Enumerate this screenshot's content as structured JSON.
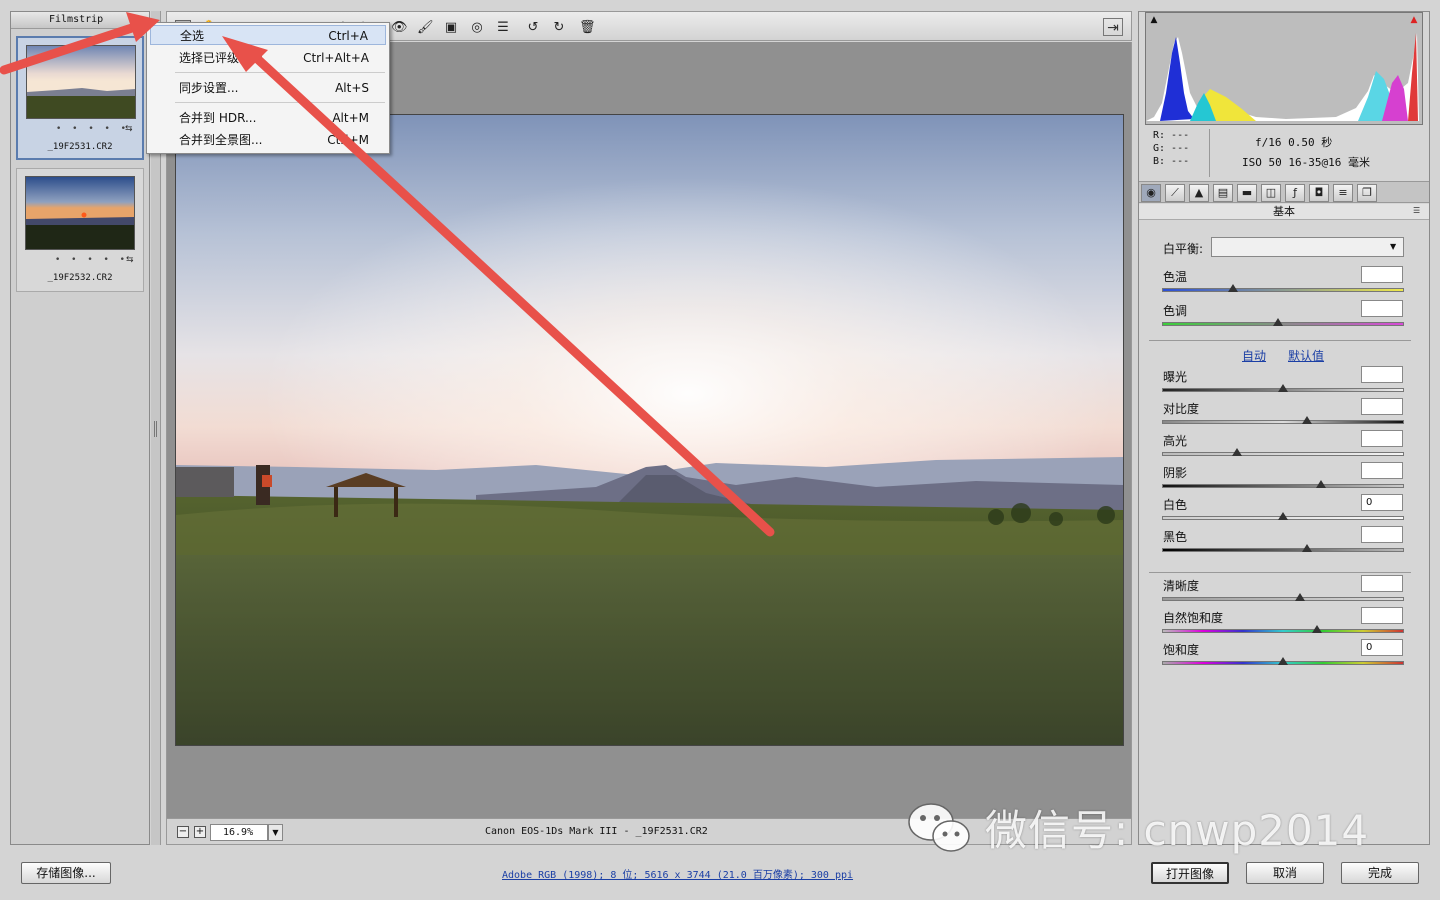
{
  "filmstrip": {
    "title": "Filmstrip",
    "items": [
      {
        "name": "_19F2531.CR2",
        "stars": "• • • • •",
        "selected": true
      },
      {
        "name": "_19F2532.CR2",
        "stars": "• • • • •",
        "selected": false
      }
    ]
  },
  "context_menu": {
    "items": [
      {
        "label": "全选",
        "shortcut": "Ctrl+A"
      },
      {
        "label": "选择已评级图像",
        "shortcut": "Ctrl+Alt+A"
      },
      {
        "label": "同步设置...",
        "shortcut": "Alt+S"
      },
      {
        "label": "合并到 HDR...",
        "shortcut": "Alt+M"
      },
      {
        "label": "合并到全景图...",
        "shortcut": "Ctrl+M"
      }
    ]
  },
  "toolbar": {
    "icons": [
      "zoom-tool-icon",
      "hand-tool-icon",
      "white-balance-tool-icon",
      "color-sampler-icon",
      "target-adjust-icon",
      "crop-tool-icon",
      "straighten-tool-icon",
      "spot-removal-icon",
      "red-eye-icon",
      "adjustment-brush-icon",
      "graduated-filter-icon",
      "radial-filter-icon",
      "preferences-icon",
      "rotate-left-icon",
      "rotate-right-icon",
      "delete-icon",
      "fullscreen-icon"
    ]
  },
  "status": {
    "zoom": "16.9%",
    "camera": "Canon EOS-1Ds Mark III -  _19F2531.CR2"
  },
  "histogram": {
    "rgb": {
      "r": "R:  ---",
      "g": "G:  ---",
      "b": "B:  ---"
    },
    "exif_line1": "f/16   0.50 秒",
    "exif_line2": "ISO 50   16-35@16 毫米"
  },
  "panel": {
    "title": "基本",
    "white_balance_label": "白平衡:",
    "white_balance_value": "",
    "temperature_label": "色温",
    "tint_label": "色调",
    "auto_link": "自动",
    "default_link": "默认值",
    "controls": [
      {
        "label": "曝光",
        "value": "",
        "level": 0.5
      },
      {
        "label": "对比度",
        "value": "",
        "level": 0.6
      },
      {
        "label": "高光",
        "value": "",
        "level": 0.31
      },
      {
        "label": "阴影",
        "value": "",
        "level": 0.66
      },
      {
        "label": "白色",
        "value": "0",
        "level": 0.5
      },
      {
        "label": "黑色",
        "value": "",
        "level": 0.6
      }
    ],
    "presence": [
      {
        "label": "清晰度",
        "value": "",
        "level": 0.57
      },
      {
        "label": "自然饱和度",
        "value": "",
        "level": 0.64
      },
      {
        "label": "饱和度",
        "value": "0",
        "level": 0.5
      }
    ],
    "temperature_level": 0.29,
    "tint_level": 0.48
  },
  "bottom": {
    "save_label": "存储图像...",
    "workflow_text": "Adobe RGB (1998); 8 位; 5616 x 3744 (21.0 百万像素); 300 ppi",
    "open_label": "打开图像",
    "cancel_label": "取消",
    "done_label": "完成"
  },
  "watermark": {
    "text": "微信号: cnwp2014"
  },
  "colors": {
    "accent": "#5b7cae",
    "annotation_arrow": "#e8514a",
    "link": "#1b3fa5"
  }
}
